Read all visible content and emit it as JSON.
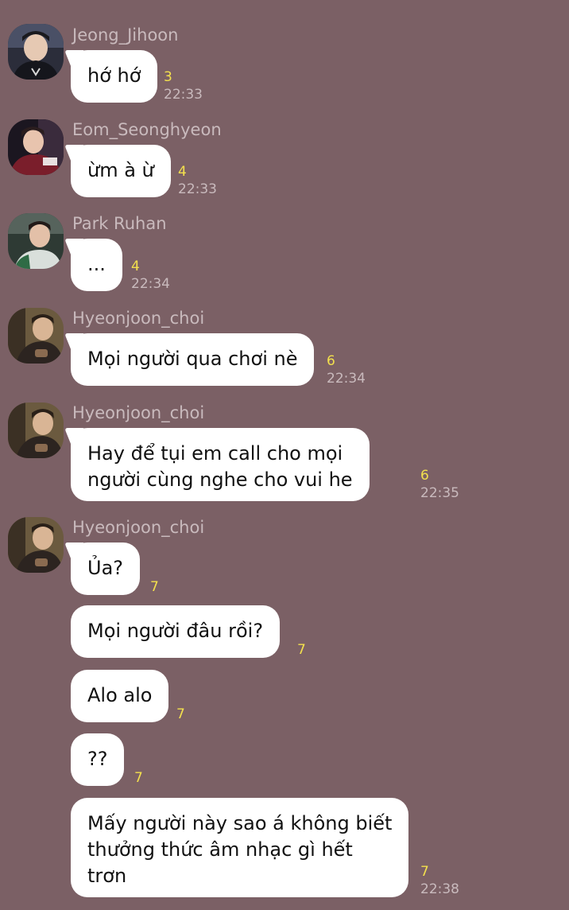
{
  "messages": [
    {
      "sender": "Jeong_Jihoon",
      "avatar": "profile-photo-jeong-jihoon",
      "bubbles": [
        {
          "lines": [
            "hớ hớ"
          ],
          "count": "3",
          "time": "22:33"
        }
      ]
    },
    {
      "sender": "Eom_Seonghyeon",
      "avatar": "profile-photo-eom-seonghyeon",
      "bubbles": [
        {
          "lines": [
            "ừm à ừ"
          ],
          "count": "4",
          "time": "22:33"
        }
      ]
    },
    {
      "sender": "Park Ruhan",
      "avatar": "profile-photo-park-ruhan",
      "bubbles": [
        {
          "lines": [
            "..."
          ],
          "count": "4",
          "time": "22:34"
        }
      ]
    },
    {
      "sender": "Hyeonjoon_choi",
      "avatar": "profile-photo-hyeonjoon-choi",
      "bubbles": [
        {
          "lines": [
            "Mọi người qua chơi nè"
          ],
          "count": "6",
          "time": "22:34"
        }
      ]
    },
    {
      "sender": "Hyeonjoon_choi",
      "avatar": "profile-photo-hyeonjoon-choi",
      "bubbles": [
        {
          "lines": [
            "Hay để tụi em call cho mọi",
            "người cùng nghe cho vui he"
          ],
          "count": "6",
          "time": "22:35"
        }
      ]
    },
    {
      "sender": "Hyeonjoon_choi",
      "avatar": "profile-photo-hyeonjoon-choi",
      "bubbles": [
        {
          "lines": [
            "Ủa?"
          ],
          "count": "7"
        },
        {
          "lines": [
            "Mọi người đâu rồi?"
          ],
          "count": "7"
        },
        {
          "lines": [
            "Alo alo"
          ],
          "count": "7"
        },
        {
          "lines": [
            "??"
          ],
          "count": "7"
        },
        {
          "lines": [
            "Mấy người này sao á không biết",
            "thưởng thức âm nhạc gì hết",
            "trơn"
          ],
          "count": "7",
          "time": "22:38"
        }
      ]
    }
  ],
  "colors": {
    "background": "#7b6065",
    "bubble": "#ffffff",
    "unread_count": "#f3e04d",
    "meta_text": "#c9babd"
  }
}
